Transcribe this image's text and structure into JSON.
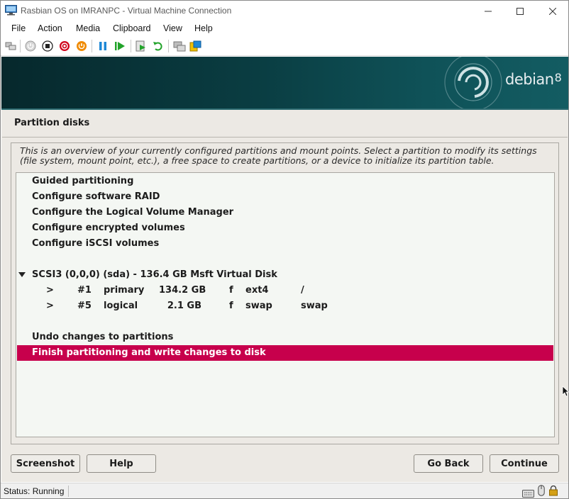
{
  "window": {
    "title": "Rasbian OS on IMRANPC - Virtual Machine Connection"
  },
  "menu": [
    "File",
    "Action",
    "Media",
    "Clipboard",
    "View",
    "Help"
  ],
  "toolbar": {
    "buttons": [
      "ctrl-alt-del-icon",
      "start-icon",
      "turn-off-icon",
      "shut-down-icon",
      "save-icon",
      "pause-icon",
      "resume-icon",
      "checkpoint-icon",
      "revert-icon",
      "enhanced-session-icon",
      "share-icon"
    ]
  },
  "banner": {
    "brand": "debian",
    "version": "8"
  },
  "installer": {
    "step_title": "Partition disks",
    "description": "This is an overview of your currently configured partitions and mount points. Select a partition to modify its settings (file system, mount point, etc.), a free space to create partitions, or a device to initialize its partition table.",
    "menu_items": [
      "Guided partitioning",
      "Configure software RAID",
      "Configure the Logical Volume Manager",
      "Configure encrypted volumes",
      "Configure iSCSI volumes"
    ],
    "disk": "SCSI3 (0,0,0) (sda) - 136.4 GB Msft Virtual Disk",
    "partitions": [
      {
        "arrow": ">",
        "number": "#1",
        "type": "primary",
        "size": "134.2 GB",
        "flag": "f",
        "fs": "ext4",
        "mount": "/"
      },
      {
        "arrow": ">",
        "number": "#5",
        "type": "logical",
        "size": "2.1 GB",
        "flag": "f",
        "fs": "swap",
        "mount": "swap"
      }
    ],
    "undo": "Undo changes to partitions",
    "finish": "Finish partitioning and write changes to disk",
    "buttons": {
      "screenshot": "Screenshot",
      "help": "Help",
      "go_back": "Go Back",
      "continue": "Continue"
    }
  },
  "statusbar": {
    "status": "Status: Running"
  },
  "colors": {
    "selection": "#c7004c",
    "banner": "#0a3d42",
    "installer_bg": "#ece9e4"
  }
}
